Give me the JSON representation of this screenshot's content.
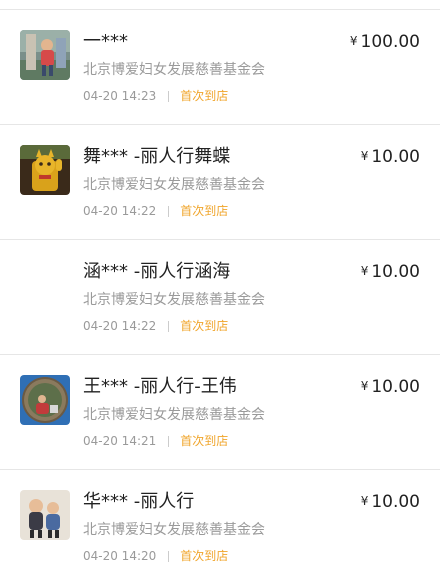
{
  "donations": [
    {
      "name": "一***",
      "currency": "¥",
      "amount": "100.00",
      "org": "北京博爱妇女发展慈善基金会",
      "time": "04-20 14:23",
      "tag": "首次到店",
      "avatar": "photo-child-outdoor"
    },
    {
      "name": "舞*** -丽人行舞蝶",
      "currency": "¥",
      "amount": "10.00",
      "org": "北京博爱妇女发展慈善基金会",
      "time": "04-20 14:22",
      "tag": "首次到店",
      "avatar": "photo-lucky-cat"
    },
    {
      "name": "涵*** -丽人行涵海",
      "currency": "¥",
      "amount": "10.00",
      "org": "北京博爱妇女发展慈善基金会",
      "time": "04-20 14:22",
      "tag": "首次到店",
      "avatar": "none"
    },
    {
      "name": "王*** -丽人行-王伟",
      "currency": "¥",
      "amount": "10.00",
      "org": "北京博爱妇女发展慈善基金会",
      "time": "04-20 14:21",
      "tag": "首次到店",
      "avatar": "photo-circle-person"
    },
    {
      "name": "华*** -丽人行",
      "currency": "¥",
      "amount": "10.00",
      "org": "北京博爱妇女发展慈善基金会",
      "time": "04-20 14:20",
      "tag": "首次到店",
      "avatar": "photo-two-children"
    }
  ],
  "colors": {
    "tag": "#f0a52b",
    "secondary_text": "#9a9a9a",
    "primary_text": "#222222",
    "divider": "#e6e6e6"
  }
}
